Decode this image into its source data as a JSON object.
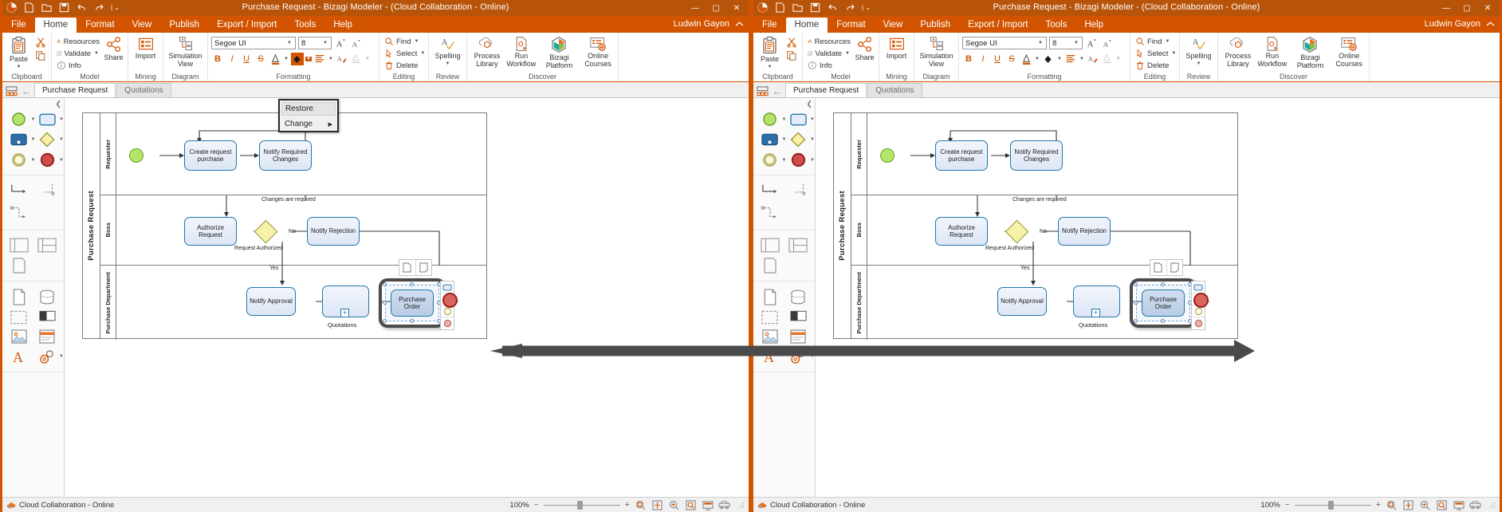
{
  "window": {
    "title": "Purchase Request - Bizagi Modeler - (Cloud Collaboration - Online)",
    "user": "Ludwin Gayon",
    "collapse_icon": "chevron-up-icon"
  },
  "quick_access": [
    "bizagi-logo-icon",
    "new-icon",
    "open-icon",
    "save-icon",
    "undo-icon",
    "redo-icon",
    "customize-icon"
  ],
  "menu": {
    "items": [
      {
        "label": "File",
        "active": false
      },
      {
        "label": "Home",
        "active": true
      },
      {
        "label": "Format",
        "active": false
      },
      {
        "label": "View",
        "active": false
      },
      {
        "label": "Publish",
        "active": false
      },
      {
        "label": "Export / Import",
        "active": false
      },
      {
        "label": "Tools",
        "active": false
      },
      {
        "label": "Help",
        "active": false
      }
    ]
  },
  "ribbon": {
    "groups": [
      {
        "label": "Clipboard"
      },
      {
        "label": "Model"
      },
      {
        "label": "Mining"
      },
      {
        "label": "Diagram"
      },
      {
        "label": "Formatting"
      },
      {
        "label": "Editing"
      },
      {
        "label": "Review"
      },
      {
        "label": "Discover"
      }
    ],
    "clipboard": {
      "paste": "Paste",
      "cut": "cut-icon",
      "copy": "copy-icon"
    },
    "model": {
      "resources": "Resources",
      "validate": "Validate",
      "info": "Info",
      "share": "Share"
    },
    "mining": {
      "import": "Import"
    },
    "diagram": {
      "simulation": "Simulation View"
    },
    "formatting": {
      "font_name": "Segoe UI",
      "font_size": "8",
      "grow_font": "grow-font-icon",
      "shrink_font": "shrink-font-icon",
      "bold": "B",
      "italic": "I",
      "underline": "U",
      "strikethrough": "S",
      "font_color": "font-color-icon",
      "fill_color": "fill-color-icon",
      "align": "align-icon",
      "format_painter": "format-painter-icon",
      "line_color": "line-color-icon"
    },
    "editing": {
      "find": "Find",
      "select": "Select",
      "delete": "Delete"
    },
    "review": {
      "spelling": "Spelling"
    },
    "discover": {
      "process_library": "Process Library",
      "run_workflow": "Run Workflow",
      "bizagi_platform": "Bizagi Platform",
      "online_courses": "Online Courses"
    }
  },
  "fill_dropdown": {
    "visible_in": "left",
    "items": [
      {
        "label": "Restore",
        "highlighted": true,
        "submenu": false
      },
      {
        "label": "Change",
        "highlighted": false,
        "submenu": true
      }
    ],
    "submenu_arrow": "chevron-right-icon"
  },
  "document_tabs": {
    "nav_icon": "diagram-list-icon",
    "back_icon": "back-arrow-icon",
    "tabs": [
      {
        "label": "Purchase Request",
        "active": true
      },
      {
        "label": "Quotations",
        "active": false
      }
    ]
  },
  "palette": {
    "collapse_icon": "chevron-left-icon",
    "sections": [
      {
        "items": [
          {
            "name": "start-event-shape",
            "caret": true
          },
          {
            "name": "task-shape",
            "caret": true
          },
          {
            "name": "subprocess-shape",
            "caret": true
          },
          {
            "name": "gateway-shape",
            "caret": true
          },
          {
            "name": "intermediate-event-shape",
            "caret": true
          },
          {
            "name": "end-event-shape",
            "caret": true
          }
        ]
      },
      {
        "items": [
          {
            "name": "sequence-flow-shape",
            "caret": false
          },
          {
            "name": "message-flow-shape",
            "caret": false
          },
          {
            "name": "association-shape",
            "caret": false
          }
        ]
      },
      {
        "items": [
          {
            "name": "pool-shape",
            "caret": false
          },
          {
            "name": "lane-shape",
            "caret": false
          },
          {
            "name": "milestone-shape",
            "caret": false
          }
        ]
      },
      {
        "items": [
          {
            "name": "data-object-shape",
            "caret": false
          },
          {
            "name": "data-store-shape",
            "caret": false
          },
          {
            "name": "group-shape",
            "caret": false
          },
          {
            "name": "annotation-shape",
            "caret": false
          },
          {
            "name": "image-shape",
            "caret": false
          },
          {
            "name": "header-shape",
            "caret": false
          },
          {
            "name": "text-shape",
            "caret": false
          },
          {
            "name": "artifacts-shape",
            "caret": true
          }
        ]
      }
    ]
  },
  "diagram": {
    "pool": "Purchase Request",
    "lanes": [
      "Requester",
      "Boss",
      "Purchase Department"
    ],
    "tasks": [
      {
        "id": "create",
        "label": "Create request purchase"
      },
      {
        "id": "notify_changes",
        "label": "Notify Required Changes"
      },
      {
        "id": "authorize",
        "label": "Authorize Request"
      },
      {
        "id": "notify_rejection",
        "label": "Notify Rejection"
      },
      {
        "id": "notify_approval",
        "label": "Notify Approval"
      },
      {
        "id": "purchase_order",
        "label": "Purchase Order"
      }
    ],
    "subprocess": {
      "label": "Quotations",
      "marker": "plus-marker-icon"
    },
    "flow_labels": [
      {
        "id": "changes_required",
        "text": "Changes are required"
      },
      {
        "id": "no",
        "text": "No"
      },
      {
        "id": "request_authorized",
        "text": "Request Authorized"
      },
      {
        "id": "yes",
        "text": "Yes"
      }
    ],
    "selected_element": "Purchase Order",
    "context_palette": [
      "task-mini-icon",
      "gateway-mini-icon",
      "event-mini-icon",
      "end-event-mini-icon"
    ],
    "hover_tools": [
      "copy-tool-icon",
      "paste-tool-icon"
    ]
  },
  "statusbar": {
    "cloud_icon": "cloud-collab-icon",
    "status": "Cloud Collaboration - Online",
    "zoom": "100%",
    "minus": "−",
    "plus": "+",
    "icons": [
      "zoom-selection-icon",
      "fit-page-icon",
      "zoom-in-icon",
      "actual-size-icon",
      "presentation-icon",
      "pan-icon"
    ]
  }
}
